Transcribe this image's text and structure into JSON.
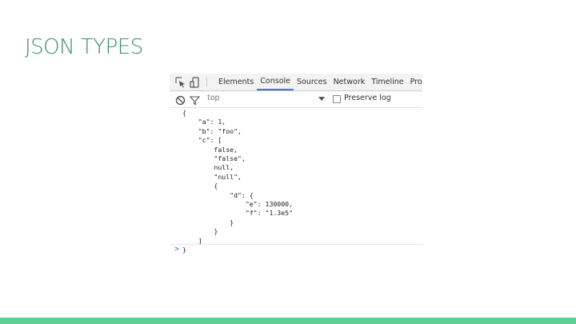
{
  "slide": {
    "title": "JSON TYPES"
  },
  "devtools": {
    "tabs": [
      {
        "label": "Elements",
        "active": false
      },
      {
        "label": "Console",
        "active": true
      },
      {
        "label": "Sources",
        "active": false
      },
      {
        "label": "Network",
        "active": false
      },
      {
        "label": "Timeline",
        "active": false
      },
      {
        "label": "Profiles",
        "active": false
      }
    ],
    "filter": {
      "context": "top",
      "preserve_log_label": "Preserve log",
      "preserve_log_checked": false
    },
    "console": {
      "output": "{\n    \"a\": 1,\n    \"b\": \"foo\",\n    \"c\": [\n        false,\n        \"false\",\n        null,\n        \"null\",\n        {\n            \"d\": {\n                \"e\": 130000,\n                \"f\": \"1.3e5\"\n            }\n        }\n    ]\n}",
      "prompt": ">",
      "input_value": ""
    },
    "icons": {
      "inspect": "cursor-arrow-icon",
      "device": "device-mode-icon",
      "clear": "clear-console-icon",
      "filter": "filter-funnel-icon",
      "dropdown": "chevron-down-icon"
    },
    "colors": {
      "accent": "#3879d9",
      "toolbar": "#f3f3f3"
    }
  },
  "theme": {
    "title_color": "#3a8f6b",
    "bottom_bar": "#5fcf96"
  }
}
